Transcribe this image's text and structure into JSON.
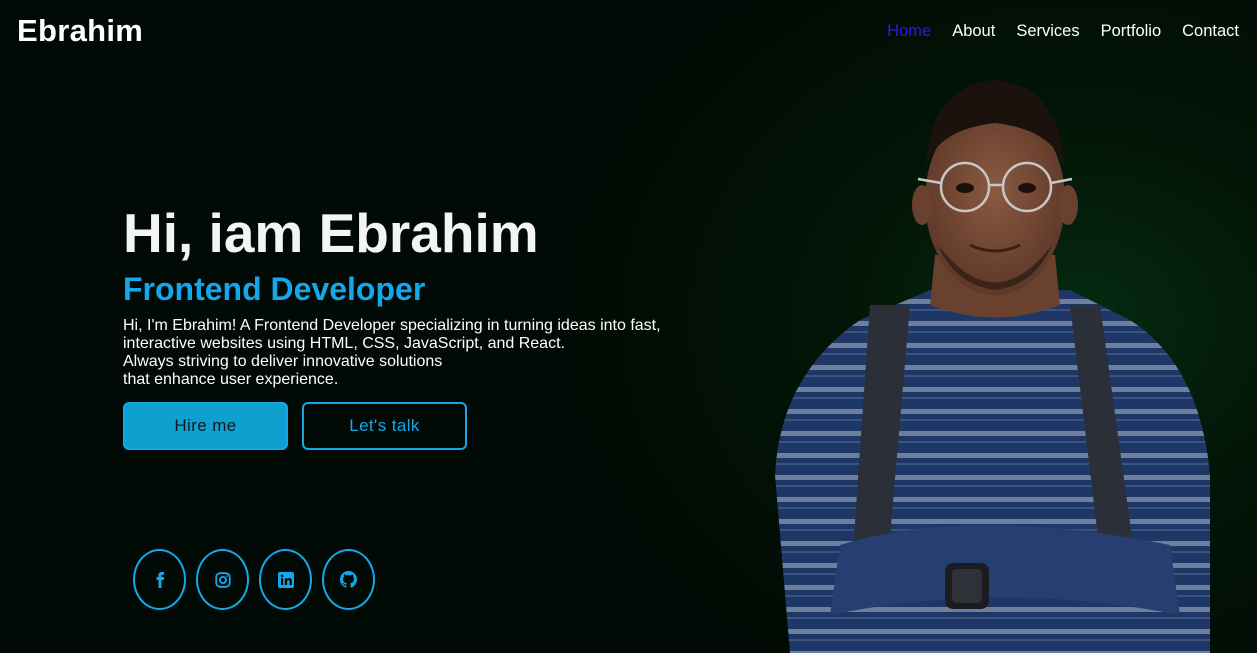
{
  "header": {
    "logo": "Ebrahim",
    "nav": [
      {
        "label": "Home",
        "active": true
      },
      {
        "label": "About",
        "active": false
      },
      {
        "label": "Services",
        "active": false
      },
      {
        "label": "Portfolio",
        "active": false
      },
      {
        "label": "Contact",
        "active": false
      }
    ],
    "active_color": "#2a1de0"
  },
  "hero": {
    "title": "Hi, iam Ebrahim",
    "role": "Frontend Developer",
    "description_lines": [
      "Hi, I'm Ebrahim! A Frontend Developer specializing in turning ideas into fast,",
      "interactive websites using HTML, CSS, JavaScript, and React.",
      "Always striving to deliver innovative solutions",
      "that enhance user experience."
    ],
    "buttons": {
      "hire": "Hire me",
      "talk": "Let's talk"
    }
  },
  "socials": [
    {
      "icon": "facebook-icon"
    },
    {
      "icon": "instagram-icon"
    },
    {
      "icon": "linkedin-icon"
    },
    {
      "icon": "github-icon"
    }
  ],
  "colors": {
    "accent": "#14a8ea",
    "background": "#010a04",
    "glow": "#052a10"
  }
}
